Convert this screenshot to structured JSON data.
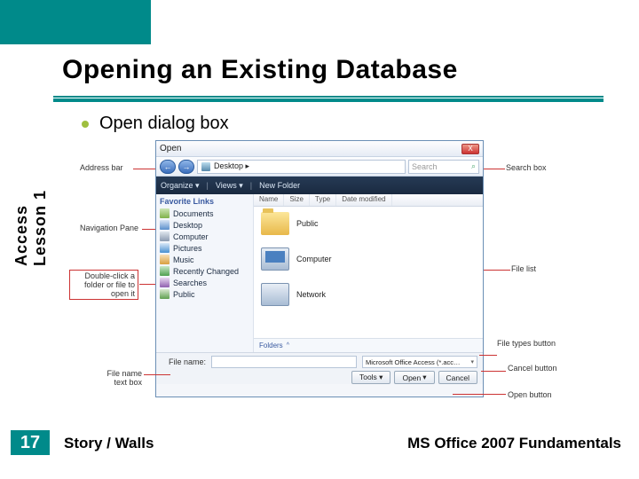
{
  "title": "Opening an Existing Database",
  "bullet": "Open dialog box",
  "side_label_line1": "Access",
  "side_label_line2": "Lesson 1",
  "page_number": "17",
  "footer_left": "Story / Walls",
  "footer_right": "MS Office 2007 Fundamentals",
  "dialog": {
    "title": "Open",
    "close": "X",
    "nav_back": "←",
    "nav_fwd": "→",
    "breadcrumb": "Desktop  ▸",
    "search_placeholder": "Search",
    "toolbar": {
      "organize": "Organize ▾",
      "views": "Views ▾",
      "newfolder": "New Folder"
    },
    "fav_header": "Favorite Links",
    "fav": [
      "Documents",
      "Desktop",
      "Computer",
      "Pictures",
      "Music",
      "Recently Changed",
      "Searches",
      "Public"
    ],
    "cols": {
      "name": "Name",
      "size": "Size",
      "type": "Type",
      "date": "Date modified"
    },
    "items": [
      "Public",
      "Computer",
      "Network"
    ],
    "folders": "Folders",
    "chev": "^",
    "filename_label": "File name:",
    "filetypes": "Microsoft Office Access (*.acc…",
    "tools": "Tools ▾",
    "open": "Open",
    "open_dd": "▾",
    "cancel": "Cancel"
  },
  "callouts": {
    "address_bar": "Address bar",
    "nav_pane": "Navigation Pane",
    "dblclick": "Double-click a folder or file to open it",
    "filename_box": "File name text box",
    "search_box": "Search box",
    "file_list": "File list",
    "filetypes_btn": "File types button",
    "cancel_btn": "Cancel button",
    "open_btn": "Open button"
  }
}
